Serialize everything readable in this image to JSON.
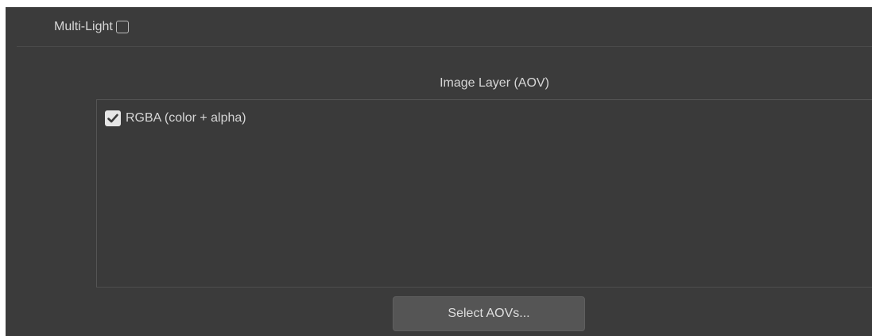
{
  "multi_light": {
    "label": "Multi-Light",
    "checked": false
  },
  "aov_section": {
    "title": "Image Layer (AOV)",
    "items": [
      {
        "label": "RGBA (color + alpha)",
        "checked": true
      }
    ]
  },
  "select_button": {
    "label": "Select AOVs..."
  },
  "colors": {
    "panel_background": "#3b3b3b",
    "text": "#d6d6d6",
    "button_background": "#555555",
    "checkbox_checked": "#e6e6e6"
  },
  "icons": {
    "check": "checkmark-icon"
  }
}
